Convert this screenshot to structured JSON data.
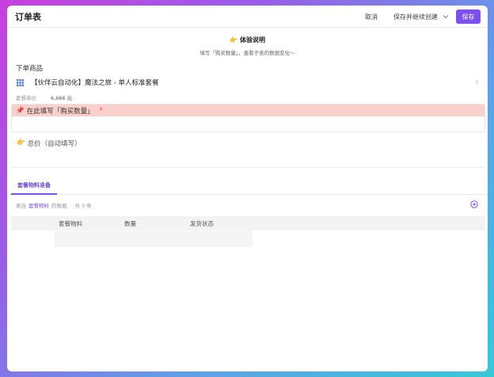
{
  "header": {
    "title": "订单表",
    "cancel_label": "取消",
    "save_continue_label": "保存并继续创建",
    "save_label": "保存"
  },
  "notice": {
    "emoji": "👉",
    "title": "体验说明",
    "subtitle": "填写「购买数量」，查看子表的数据变化～"
  },
  "product_field": {
    "label": "下单商品",
    "value": "【伙伴云自动化】魔法之旅 - 单人标准套餐",
    "price_label": "套餐单价",
    "price_value": "6,666 元"
  },
  "quantity_field": {
    "emoji": "📌",
    "label": "在此填写「购买数量」",
    "required_mark": "*",
    "value": ""
  },
  "total_field": {
    "emoji": "👉",
    "label": "总价（自动填写）",
    "value": ""
  },
  "tabs": [
    {
      "label": "套餐物料准备",
      "active": true
    }
  ],
  "related": {
    "prefix": "来自",
    "table_name": "套餐物料",
    "suffix": "的数据",
    "count": "共 0 条"
  },
  "table": {
    "columns": [
      "套餐物料",
      "数量",
      "发货状态"
    ]
  },
  "colors": {
    "accent": "#7b4ff0",
    "highlight": "#fbd0cc",
    "required": "#e74c3c"
  }
}
